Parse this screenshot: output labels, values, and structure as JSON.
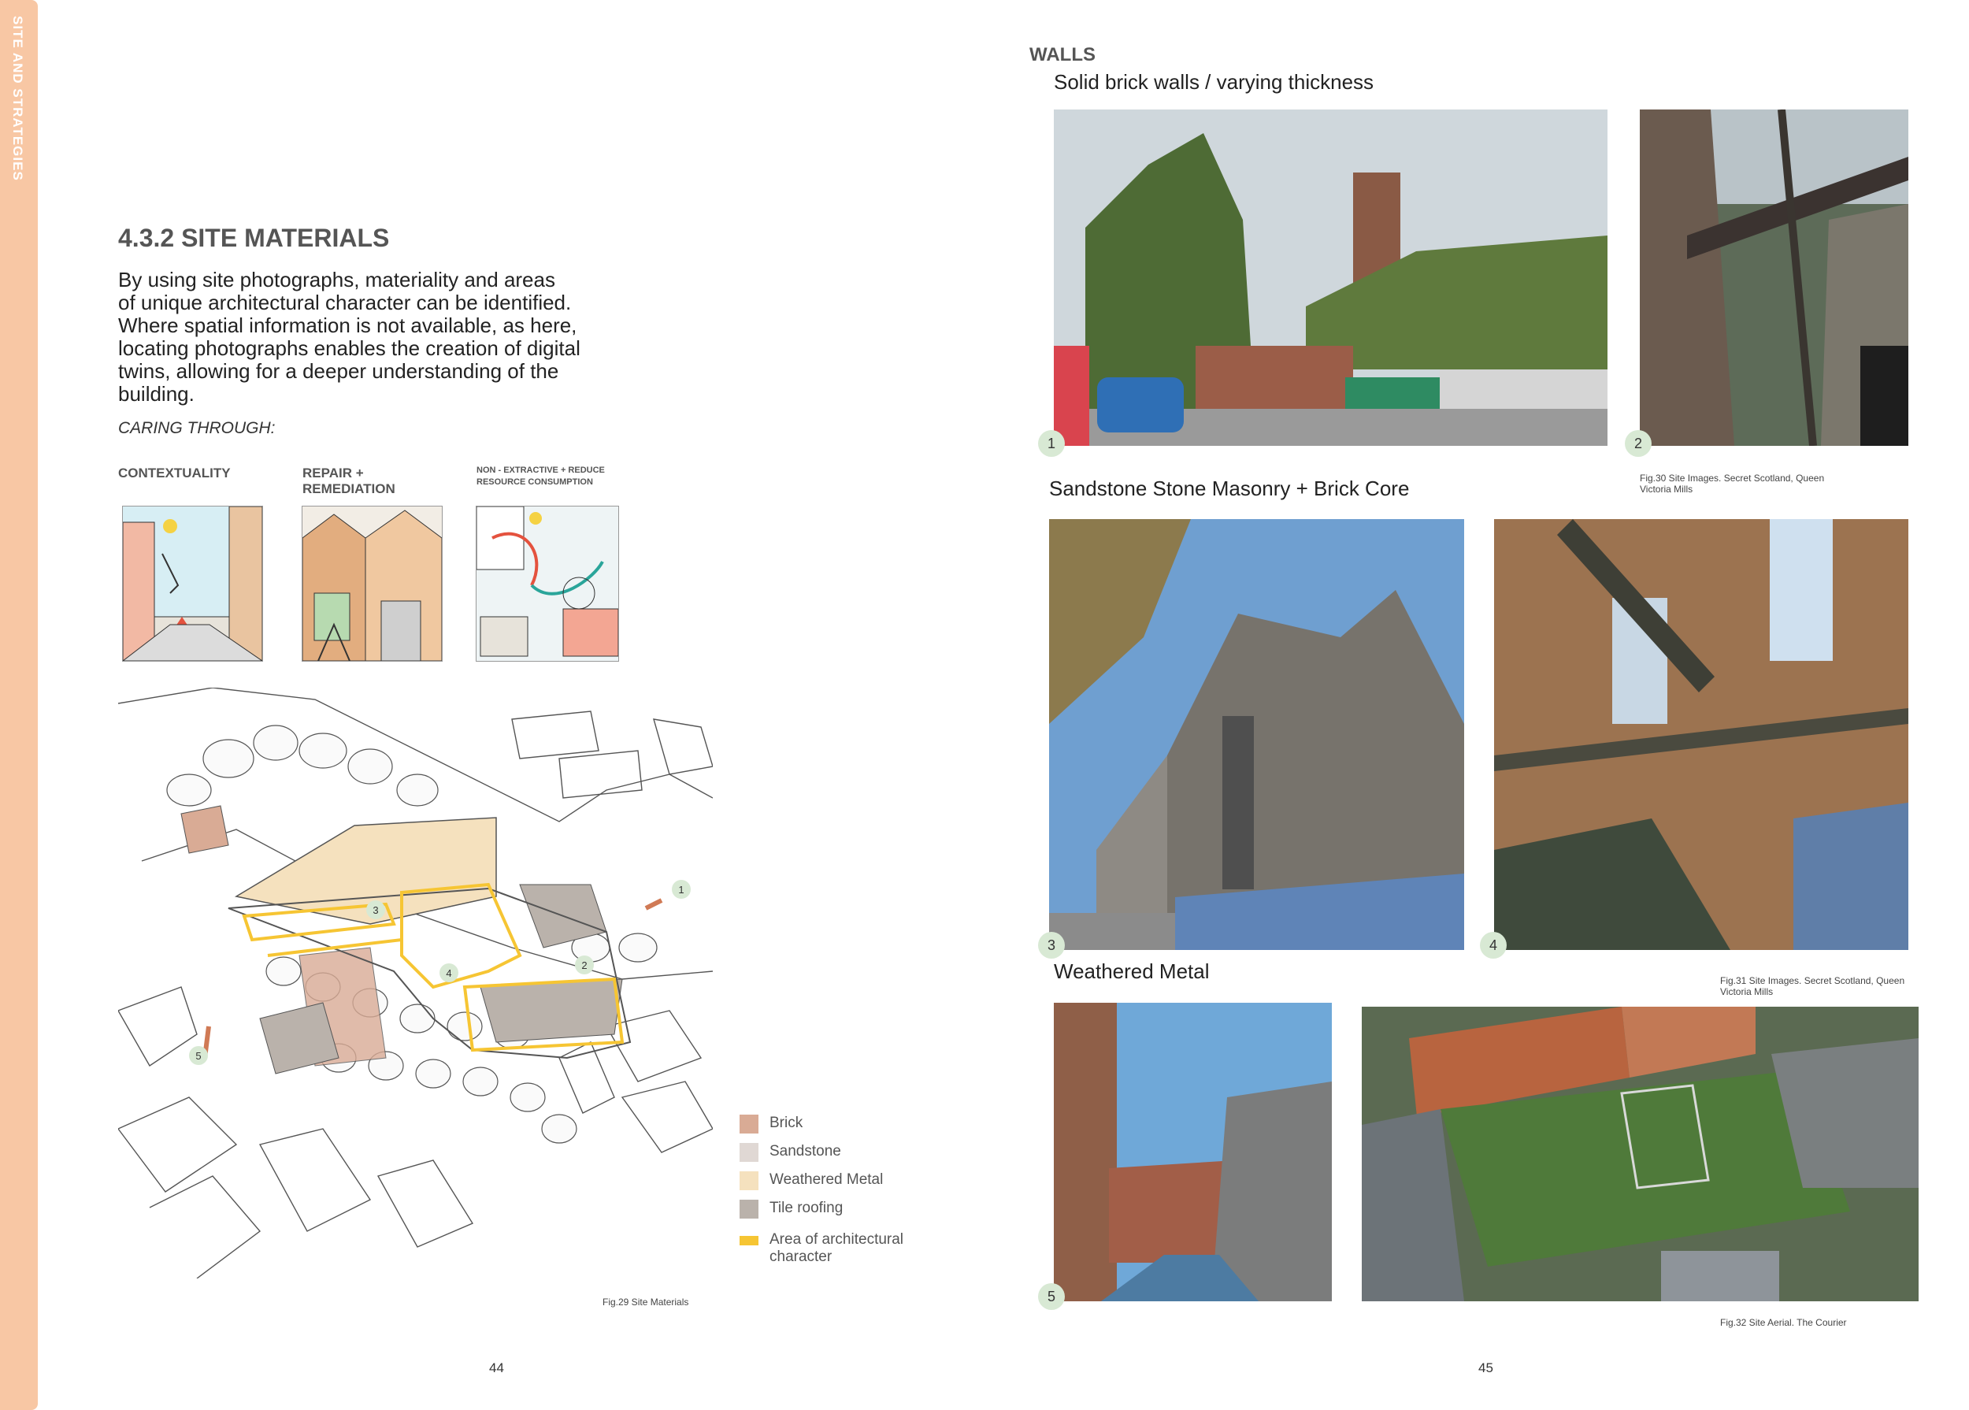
{
  "sidebar": {
    "label": "SITE AND STRATEGIES"
  },
  "left_page": {
    "heading": "4.3.2 SITE MATERIALS",
    "body_lines": [
      "By using site photographs, materiality and areas",
      "of unique architectural character can be identified.",
      "Where spatial information is not available, as here,",
      "locating photographs enables the creation of digital",
      "twins, allowing for a deeper understanding of the",
      "building."
    ],
    "caring": "CARING THROUGH:",
    "strategies": [
      {
        "label": "CONTEXTUALITY"
      },
      {
        "label": "REPAIR + REMEDIATION"
      },
      {
        "label": "NON - EXTRACTIVE + REDUCE RESOURCE CONSUMPTION"
      }
    ],
    "map_markers": [
      "1",
      "2",
      "3",
      "4",
      "5"
    ],
    "legend": [
      {
        "label": "Brick",
        "color": "#d9ab95"
      },
      {
        "label": "Sandstone",
        "color": "#e0d8d4"
      },
      {
        "label": "Weathered Metal",
        "color": "#f5e1be"
      },
      {
        "label": "Tile roofing",
        "color": "#bab2ab"
      },
      {
        "label": "Area of architectural character",
        "color": "#f6c533"
      }
    ],
    "fig_caption": "Fig.29 Site Materials",
    "page_number": "44"
  },
  "right_page": {
    "walls_title": "WALLS",
    "sub1": "Solid brick walls / varying thickness",
    "sub2": "Sandstone Stone Masonry + Brick Core",
    "sub3": "Weathered Metal",
    "photo_numbers": [
      "1",
      "2",
      "3",
      "4",
      "5"
    ],
    "fig30": "Fig.30 Site Images. Secret Scotland, Queen Victoria Mills",
    "fig31": "Fig.31 Site Images. Secret Scotland, Queen Victoria Mills",
    "fig32": "Fig.32 Site Aerial. The Courier",
    "page_number": "45"
  }
}
